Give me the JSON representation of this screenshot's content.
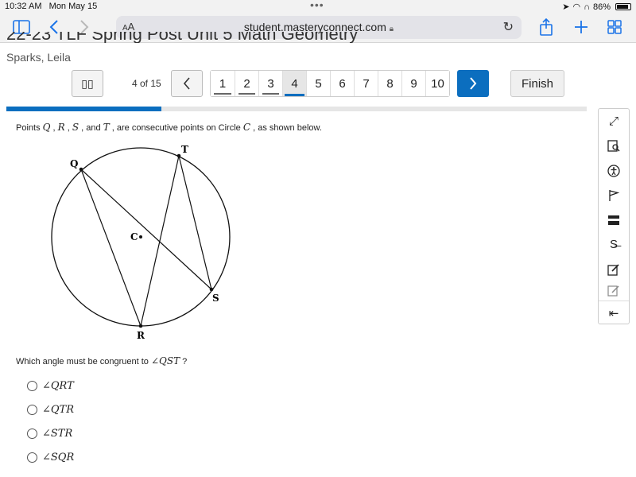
{
  "status": {
    "time": "10:32 AM",
    "date": "Mon May 15",
    "battery": "86%"
  },
  "browser": {
    "aa_big": "A",
    "aa_small": "A",
    "url": "student.masteryconnect.com"
  },
  "page": {
    "title": "22-23 TLF Spring Post Unit 5 Math Geometry",
    "student": "Sparks, Leila"
  },
  "nav": {
    "counter": "4 of 15",
    "pages": [
      "1",
      "2",
      "3",
      "4",
      "5",
      "6",
      "7",
      "8",
      "9",
      "10"
    ],
    "current_index": 3,
    "finish_label": "Finish",
    "progress": 0.267
  },
  "question": {
    "text_parts": [
      "Points ",
      "Q",
      " , ",
      "R",
      " , ",
      "S",
      " , and ",
      "T",
      " , are consecutive points on Circle ",
      "C",
      " , as shown below."
    ],
    "prompt_parts": [
      "Which angle must be congruent to ",
      "∠QST",
      " ?"
    ],
    "options": [
      "∠QRT",
      "∠QTR",
      "∠STR",
      "∠SQR"
    ]
  },
  "diagram": {
    "labels": {
      "Q": "Q",
      "R": "R",
      "S": "S",
      "T": "T",
      "C": "C"
    }
  }
}
